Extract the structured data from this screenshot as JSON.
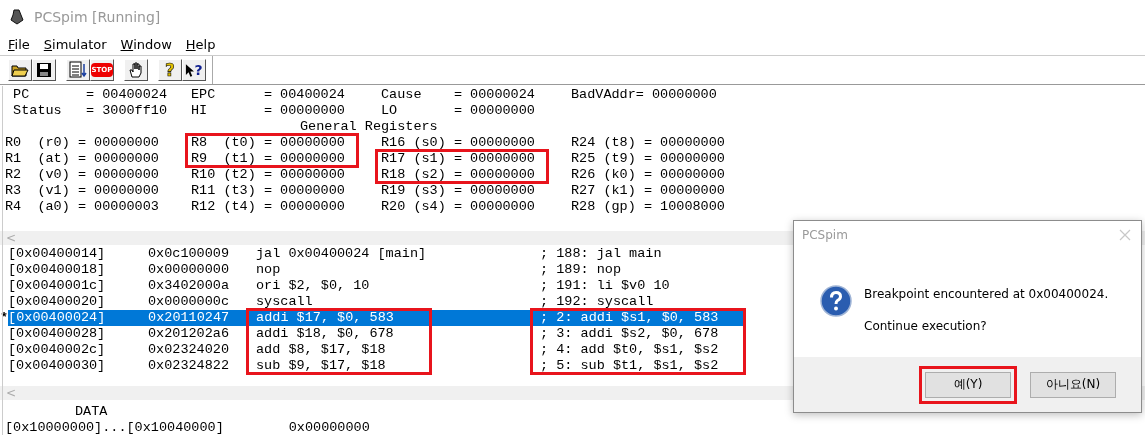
{
  "window": {
    "title": "PCSpim [Running]"
  },
  "menu": [
    "File",
    "Simulator",
    "Window",
    "Help"
  ],
  "toolbar": [
    {
      "kind": "open"
    },
    {
      "kind": "save"
    },
    {
      "kind": "step"
    },
    {
      "kind": "stop",
      "glyph": "STOP"
    },
    {
      "kind": "hand"
    },
    {
      "kind": "help",
      "glyph": "?"
    },
    {
      "kind": "context-help",
      "glyph": "?"
    }
  ],
  "special_registers": [
    [
      " PC       = 00400024",
      "EPC      = 00400024",
      "Cause    = 00000024",
      "BadVAddr= 00000000"
    ],
    [
      " Status   = 3000ff10",
      "HI       = 00000000",
      "LO       = 00000000"
    ]
  ],
  "general_title": "General Registers",
  "registers": [
    [
      {
        "text": "R0  (r0) = 00000000",
        "highlighted": false
      },
      {
        "text": "R8  (t0) = 00000000",
        "highlighted": true
      },
      {
        "text": "R16 (s0) = 00000000",
        "highlighted": false
      },
      {
        "text": "R24 (t8) = 00000000",
        "highlighted": false
      }
    ],
    [
      {
        "text": "R1  (at) = 00000000",
        "highlighted": false
      },
      {
        "text": "R9  (t1) = 00000000",
        "highlighted": true
      },
      {
        "text": "R17 (s1) = 00000000",
        "highlighted": true
      },
      {
        "text": "R25 (t9) = 00000000",
        "highlighted": false
      }
    ],
    [
      {
        "text": "R2  (v0) = 00000000",
        "highlighted": false
      },
      {
        "text": "R10 (t2) = 00000000",
        "highlighted": false
      },
      {
        "text": "R18 (s2) = 00000000",
        "highlighted": true
      },
      {
        "text": "R26 (k0) = 00000000",
        "highlighted": false
      }
    ],
    [
      {
        "text": "R3  (v1) = 00000000",
        "highlighted": false
      },
      {
        "text": "R11 (t3) = 00000000",
        "highlighted": false
      },
      {
        "text": "R19 (s3) = 00000000",
        "highlighted": false
      },
      {
        "text": "R27 (k1) = 00000000",
        "highlighted": false
      }
    ],
    [
      {
        "text": "R4  (a0) = 00000003",
        "highlighted": false
      },
      {
        "text": "R12 (t4) = 00000000",
        "highlighted": false
      },
      {
        "text": "R20 (s4) = 00000000",
        "highlighted": false
      },
      {
        "text": "R28 (gp) = 10008000",
        "highlighted": false
      }
    ]
  ],
  "scroll_arrow": "<",
  "text_segment": [
    {
      "address": "[0x00400014]",
      "code": "0x0c100009",
      "instruction": "jal 0x00400024 [main]",
      "source": "; 188: jal main",
      "selected": false,
      "highlighted": false
    },
    {
      "address": "[0x00400018]",
      "code": "0x00000000",
      "instruction": "nop",
      "source": "; 189: nop",
      "selected": false,
      "highlighted": false
    },
    {
      "address": "[0x0040001c]",
      "code": "0x3402000a",
      "instruction": "ori $2, $0, 10",
      "source": "; 191: li $v0 10",
      "selected": false,
      "highlighted": false
    },
    {
      "address": "[0x00400020]",
      "code": "0x0000000c",
      "instruction": "syscall",
      "source": "; 192: syscall",
      "selected": false,
      "highlighted": false
    },
    {
      "mark": "*",
      "address": "[0x00400024]",
      "code": "0x20110247",
      "instruction": "addi $17, $0, 583",
      "source": "; 2: addi $s1, $0, 583",
      "selected": true,
      "highlighted": true
    },
    {
      "address": "[0x00400028]",
      "code": "0x201202a6",
      "instruction": "addi $18, $0, 678",
      "source": "; 3: addi $s2, $0, 678",
      "selected": false,
      "highlighted": true
    },
    {
      "address": "[0x0040002c]",
      "code": "0x02324020",
      "instruction": "add $8, $17, $18",
      "source": "; 4: add $t0, $s1, $s2",
      "selected": false,
      "highlighted": true
    },
    {
      "address": "[0x00400030]",
      "code": "0x02324822",
      "instruction": "sub $9, $17, $18",
      "source": "; 5: sub $t1, $s1, $s2",
      "selected": false,
      "highlighted": true
    }
  ],
  "scroll_arrow_2": "<",
  "data_segment": {
    "title": "DATA",
    "rows": [
      {
        "range": "[0x10000000]...[0x10040000]",
        "value": "0x00000000"
      }
    ]
  },
  "dialog": {
    "title": "PCSpim",
    "message": "Breakpoint encountered at 0x00400024.",
    "question": "Continue execution?",
    "buttons": [
      {
        "label": "예(Y)",
        "highlighted": true
      },
      {
        "label": "아니요(N)",
        "highlighted": false
      }
    ]
  }
}
